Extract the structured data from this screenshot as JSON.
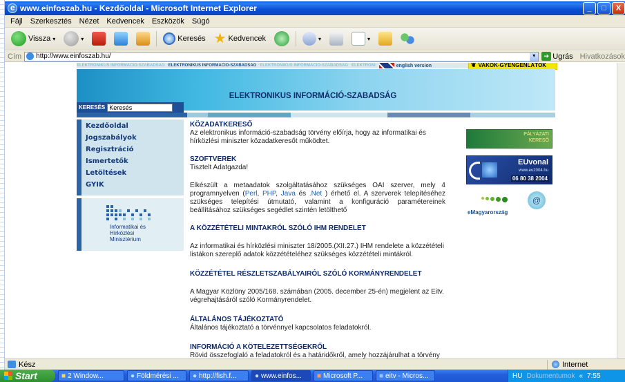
{
  "window": {
    "title": "www.einfoszab.hu - Kezdőoldal - Microsoft Internet Explorer",
    "buttons": [
      "_",
      "□",
      "X"
    ]
  },
  "menu": [
    "Fájl",
    "Szerkesztés",
    "Nézet",
    "Kedvencek",
    "Eszközök",
    "Súgó"
  ],
  "toolbar": {
    "back": "Vissza",
    "search": "Keresés",
    "favorites": "Kedvencek"
  },
  "address": {
    "label": "Cím",
    "url": "http://www.einfoszab.hu/",
    "go": "Ugrás",
    "links": "Hivatkozások"
  },
  "page": {
    "topnav": [
      "ELEKTRONIKUS INFORMÁCIÓ-SZABADSÁG",
      "ELEKTRONIKUS INFORMÁCIÓ-SZABADSÁG",
      "ELEKTRONIKUS INFORMÁCIÓ-SZABADSÁG",
      "ELEKTRONI"
    ],
    "english": "english version",
    "vakok": "VAKOK-GYENGÉNLÁTÓK",
    "header_title": "ELEKTRONIKUS INFORMÁCIÓ-SZABADSÁG",
    "search_label": "KERESÉS",
    "search_value": "Keresés",
    "nav": [
      "Kezdőoldal",
      "Jogszabályok",
      "Regisztráció",
      "Ismertetők",
      "Letöltések",
      "GYIK"
    ],
    "ministry": [
      "Informatikai és",
      "Hírközlési",
      "Minisztérium"
    ],
    "sections": [
      {
        "title": "KÖZADATKERESŐ",
        "text": "Az elektronikus információ-szabadság törvény előírja, hogy az informatikai és hírközlési miniszter közadatkeresőt működtet."
      },
      {
        "title": "SZOFTVEREK",
        "text": "Tisztelt Adatgazda!"
      },
      {
        "title": "",
        "text_pre": "Elkészült a metaadatok szolgáltatásához szükséges OAI szerver, mely 4 programnyelven (",
        "links": [
          "Perl",
          "PHP",
          "Java",
          ".Net"
        ],
        "text_post": ") érhető el. A szerverek telepítéséhez szükséges telepítési útmutató, valamint a konfiguráció paramétereinek beállításához szükséges segédlet szintén letölthető"
      },
      {
        "title": "A KÖZZÉTÉTELI MINTAKRÓL SZÓLÓ IHM RENDELET",
        "text": "Az informatikai és hírközlési miniszter 18/2005.(XII.27.) IHM rendelete a közzétételi listákon szereplő adatok közzétételéhez szükséges közzétételi mintákról."
      },
      {
        "title": "KÖZZÉTÉTEL RÉSZLETSZABÁLYAIRÓL SZÓLÓ KORMÁNYRENDELET",
        "text": "A Magyar Közlöny 2005/168. számában (2005. december 25-én) megjelent az Eitv. végrehajtásáról szóló Kormányrendelet."
      },
      {
        "title": "ÁLTALÁNOS TÁJÉKOZTATÓ",
        "text": "Általános tájékoztató a törvénnyel kapcsolatos feladatokról."
      },
      {
        "title": "INFORMÁCIÓ A KÖTELEZETTSÉGEKRŐL",
        "text": "Rövid összefoglaló a feladatokról és a határidőkről, amely hozzájárulhat a törvény által"
      }
    ],
    "ads": {
      "palyazati": [
        "PÁLYÁZATI",
        "KERESŐ"
      ],
      "euvonal": {
        "name": "EUvonal",
        "site": "www.eu2004.hu",
        "phone": "06 80 38 2004"
      },
      "emagyar": "eMagyarország"
    }
  },
  "status": {
    "left": "Kész",
    "zone": "Internet"
  },
  "taskbar": {
    "start": "Start",
    "tasks": [
      "2 Window...",
      "Földmérési ...",
      "http://fish.f...",
      "www.einfos...",
      "Microsoft P...",
      "eitv - Micros..."
    ],
    "lang": "HU",
    "docs": "Dokumentumok",
    "time": "7:55"
  }
}
